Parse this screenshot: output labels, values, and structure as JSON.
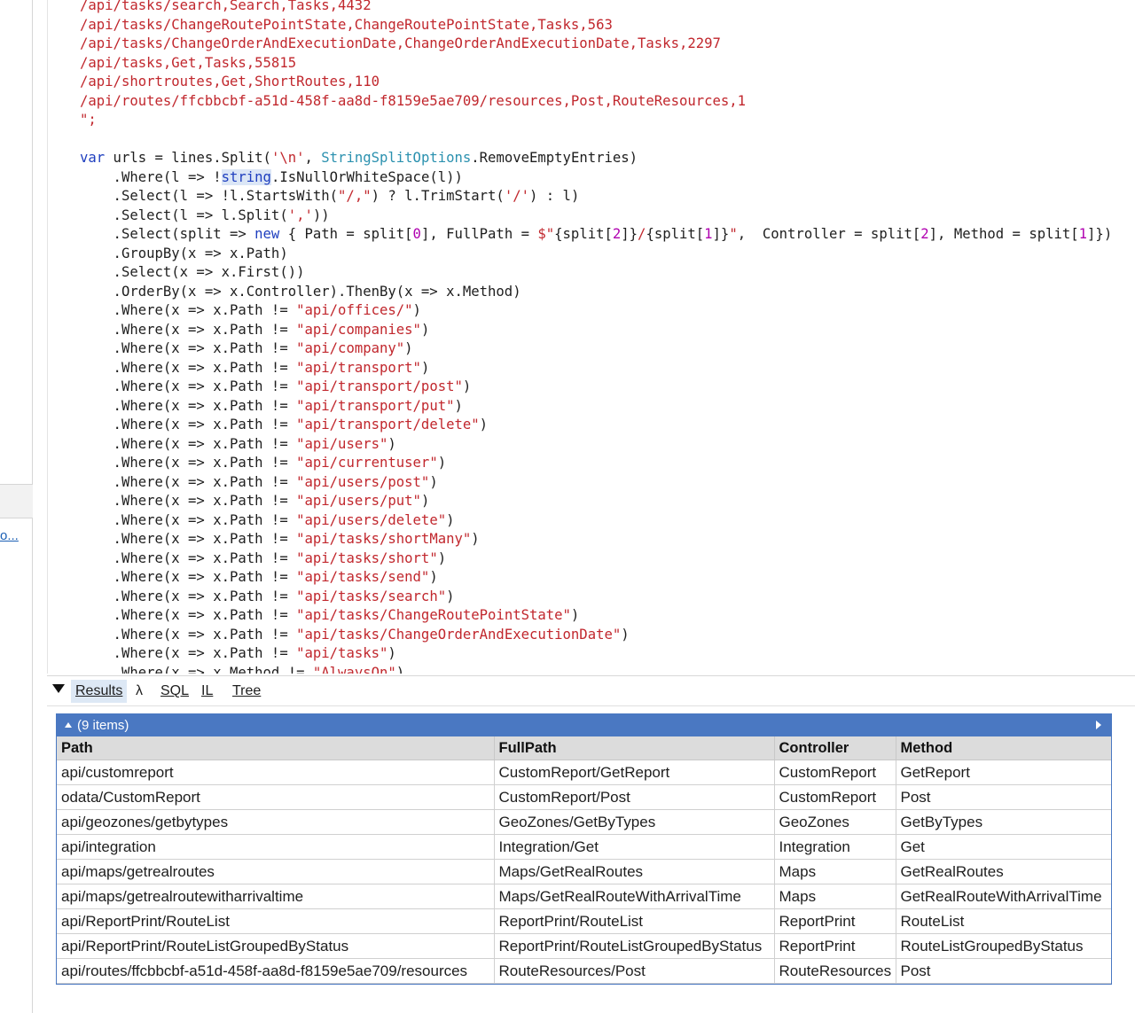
{
  "sidebar": {
    "link_text": "o..."
  },
  "code_lines": [
    [
      [
        "s",
        "/api/tasks/search,Search,Tasks,4432"
      ]
    ],
    [
      [
        "s",
        "/api/tasks/ChangeRoutePointState,ChangeRoutePointState,Tasks,563"
      ]
    ],
    [
      [
        "s",
        "/api/tasks/ChangeOrderAndExecutionDate,ChangeOrderAndExecutionDate,Tasks,2297"
      ]
    ],
    [
      [
        "s",
        "/api/tasks,Get,Tasks,55815"
      ]
    ],
    [
      [
        "s",
        "/api/shortroutes,Get,ShortRoutes,110"
      ]
    ],
    [
      [
        "s",
        "/api/routes/ffcbbcbf-a51d-458f-aa8d-f8159e5ae709/resources,Post,RouteResources,1"
      ]
    ],
    [
      [
        "s",
        "\";"
      ]
    ],
    [
      [
        "p",
        ""
      ]
    ],
    [
      [
        "k",
        "var"
      ],
      [
        "p",
        " urls = lines.Split("
      ],
      [
        "s",
        "'\\n'"
      ],
      [
        "p",
        ", "
      ],
      [
        "t",
        "StringSplitOptions"
      ],
      [
        "p",
        ".RemoveEmptyEntries)"
      ]
    ],
    [
      [
        "p",
        "    .Where(l => !"
      ],
      [
        "h",
        "string"
      ],
      [
        "p",
        ".IsNullOrWhiteSpace(l))"
      ]
    ],
    [
      [
        "p",
        "    .Select(l => !l.StartsWith("
      ],
      [
        "s",
        "\"/,\""
      ],
      [
        "p",
        ") ? l.TrimStart("
      ],
      [
        "s",
        "'/'"
      ],
      [
        "p",
        ") : l)"
      ]
    ],
    [
      [
        "p",
        "    .Select(l => l.Split("
      ],
      [
        "s",
        "','"
      ],
      [
        "p",
        "))"
      ]
    ],
    [
      [
        "p",
        "    .Select(split => "
      ],
      [
        "k",
        "new"
      ],
      [
        "p",
        " { Path = split["
      ],
      [
        "n",
        "0"
      ],
      [
        "p",
        "], FullPath = "
      ],
      [
        "s",
        "$\""
      ],
      [
        "p",
        "{split["
      ],
      [
        "n",
        "2"
      ],
      [
        "p",
        "]}"
      ],
      [
        "s",
        "/"
      ],
      [
        "p",
        "{split["
      ],
      [
        "n",
        "1"
      ],
      [
        "p",
        "]}"
      ],
      [
        "s",
        "\""
      ],
      [
        "p",
        ",  Controller = split["
      ],
      [
        "n",
        "2"
      ],
      [
        "p",
        "], Method = split["
      ],
      [
        "n",
        "1"
      ],
      [
        "p",
        "]})"
      ]
    ],
    [
      [
        "p",
        "    .GroupBy(x => x.Path)"
      ]
    ],
    [
      [
        "p",
        "    .Select(x => x.First())"
      ]
    ],
    [
      [
        "p",
        "    .OrderBy(x => x.Controller).ThenBy(x => x.Method)"
      ]
    ],
    [
      [
        "p",
        "    .Where(x => x.Path != "
      ],
      [
        "s",
        "\"api/offices/\""
      ],
      [
        "p",
        ")"
      ]
    ],
    [
      [
        "p",
        "    .Where(x => x.Path != "
      ],
      [
        "s",
        "\"api/companies\""
      ],
      [
        "p",
        ")"
      ]
    ],
    [
      [
        "p",
        "    .Where(x => x.Path != "
      ],
      [
        "s",
        "\"api/company\""
      ],
      [
        "p",
        ")"
      ]
    ],
    [
      [
        "p",
        "    .Where(x => x.Path != "
      ],
      [
        "s",
        "\"api/transport\""
      ],
      [
        "p",
        ")"
      ]
    ],
    [
      [
        "p",
        "    .Where(x => x.Path != "
      ],
      [
        "s",
        "\"api/transport/post\""
      ],
      [
        "p",
        ")"
      ]
    ],
    [
      [
        "p",
        "    .Where(x => x.Path != "
      ],
      [
        "s",
        "\"api/transport/put\""
      ],
      [
        "p",
        ")"
      ]
    ],
    [
      [
        "p",
        "    .Where(x => x.Path != "
      ],
      [
        "s",
        "\"api/transport/delete\""
      ],
      [
        "p",
        ")"
      ]
    ],
    [
      [
        "p",
        "    .Where(x => x.Path != "
      ],
      [
        "s",
        "\"api/users\""
      ],
      [
        "p",
        ")"
      ]
    ],
    [
      [
        "p",
        "    .Where(x => x.Path != "
      ],
      [
        "s",
        "\"api/currentuser\""
      ],
      [
        "p",
        ")"
      ]
    ],
    [
      [
        "p",
        "    .Where(x => x.Path != "
      ],
      [
        "s",
        "\"api/users/post\""
      ],
      [
        "p",
        ")"
      ]
    ],
    [
      [
        "p",
        "    .Where(x => x.Path != "
      ],
      [
        "s",
        "\"api/users/put\""
      ],
      [
        "p",
        ")"
      ]
    ],
    [
      [
        "p",
        "    .Where(x => x.Path != "
      ],
      [
        "s",
        "\"api/users/delete\""
      ],
      [
        "p",
        ")"
      ]
    ],
    [
      [
        "p",
        "    .Where(x => x.Path != "
      ],
      [
        "s",
        "\"api/tasks/shortMany\""
      ],
      [
        "p",
        ")"
      ]
    ],
    [
      [
        "p",
        "    .Where(x => x.Path != "
      ],
      [
        "s",
        "\"api/tasks/short\""
      ],
      [
        "p",
        ")"
      ]
    ],
    [
      [
        "p",
        "    .Where(x => x.Path != "
      ],
      [
        "s",
        "\"api/tasks/send\""
      ],
      [
        "p",
        ")"
      ]
    ],
    [
      [
        "p",
        "    .Where(x => x.Path != "
      ],
      [
        "s",
        "\"api/tasks/search\""
      ],
      [
        "p",
        ")"
      ]
    ],
    [
      [
        "p",
        "    .Where(x => x.Path != "
      ],
      [
        "s",
        "\"api/tasks/ChangeRoutePointState\""
      ],
      [
        "p",
        ")"
      ]
    ],
    [
      [
        "p",
        "    .Where(x => x.Path != "
      ],
      [
        "s",
        "\"api/tasks/ChangeOrderAndExecutionDate\""
      ],
      [
        "p",
        ")"
      ]
    ],
    [
      [
        "p",
        "    .Where(x => x.Path != "
      ],
      [
        "s",
        "\"api/tasks\""
      ],
      [
        "p",
        ")"
      ]
    ],
    [
      [
        "p",
        "    .Where(x => x.Method != "
      ],
      [
        "s",
        "\"AlwaysOn\""
      ],
      [
        "p",
        ")"
      ]
    ]
  ],
  "tabs": {
    "results": "Results",
    "lambda": "λ",
    "sql": "SQL",
    "il": "IL",
    "tree": "Tree"
  },
  "results": {
    "count_label": "(9 items)",
    "columns": [
      "Path",
      "FullPath",
      "Controller",
      "Method"
    ],
    "rows": [
      [
        "api/customreport",
        "CustomReport/GetReport",
        "CustomReport",
        "GetReport"
      ],
      [
        "odata/CustomReport",
        "CustomReport/Post",
        "CustomReport",
        "Post"
      ],
      [
        "api/geozones/getbytypes",
        "GeoZones/GetByTypes",
        "GeoZones",
        "GetByTypes"
      ],
      [
        "api/integration",
        "Integration/Get",
        "Integration",
        "Get"
      ],
      [
        "api/maps/getrealroutes",
        "Maps/GetRealRoutes",
        "Maps",
        "GetRealRoutes"
      ],
      [
        "api/maps/getrealroutewitharrivaltime",
        "Maps/GetRealRouteWithArrivalTime",
        "Maps",
        "GetRealRouteWithArrivalTime"
      ],
      [
        "api/ReportPrint/RouteList",
        "ReportPrint/RouteList",
        "ReportPrint",
        "RouteList"
      ],
      [
        "api/ReportPrint/RouteListGroupedByStatus",
        "ReportPrint/RouteListGroupedByStatus",
        "ReportPrint",
        "RouteListGroupedByStatus"
      ],
      [
        "api/routes/ffcbbcbf-a51d-458f-aa8d-f8159e5ae709/resources",
        "RouteResources/Post",
        "RouteResources",
        "Post"
      ]
    ]
  }
}
